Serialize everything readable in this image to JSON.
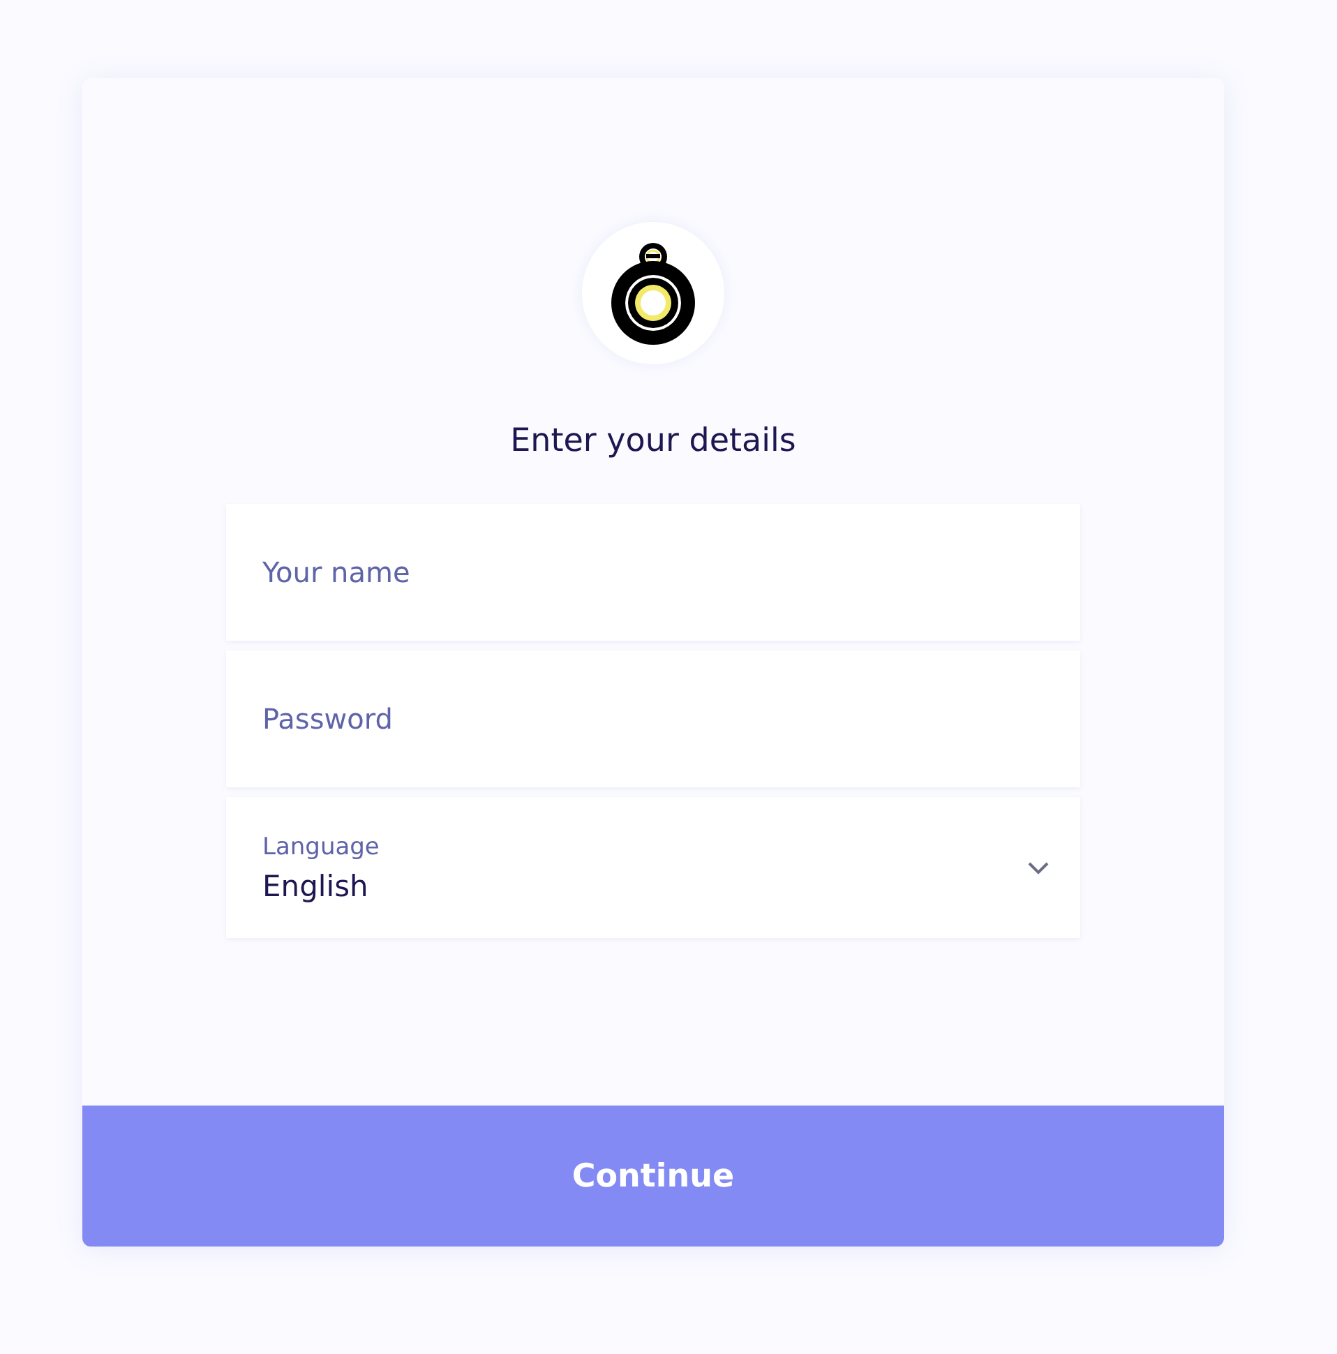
{
  "heading": "Enter your details",
  "fields": [
    {
      "kind": "text",
      "placeholder": "Your name"
    },
    {
      "kind": "text",
      "placeholder": "Password"
    },
    {
      "kind": "select",
      "label": "Language",
      "value": "English"
    }
  ],
  "button": "Continue"
}
